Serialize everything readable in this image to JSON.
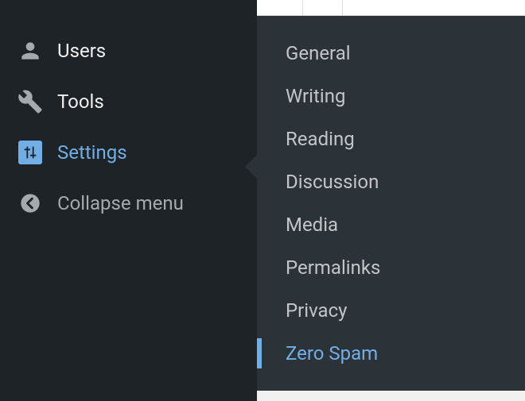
{
  "sidebar": {
    "items": [
      {
        "label": "Users"
      },
      {
        "label": "Tools"
      },
      {
        "label": "Settings"
      },
      {
        "label": "Collapse menu"
      }
    ]
  },
  "flyout": {
    "items": [
      {
        "label": "General"
      },
      {
        "label": "Writing"
      },
      {
        "label": "Reading"
      },
      {
        "label": "Discussion"
      },
      {
        "label": "Media"
      },
      {
        "label": "Permalinks"
      },
      {
        "label": "Privacy"
      },
      {
        "label": "Zero Spam"
      }
    ]
  },
  "colors": {
    "accent": "#72aee6",
    "sidebar_bg": "#1d2327",
    "flyout_bg": "#2c3338"
  }
}
